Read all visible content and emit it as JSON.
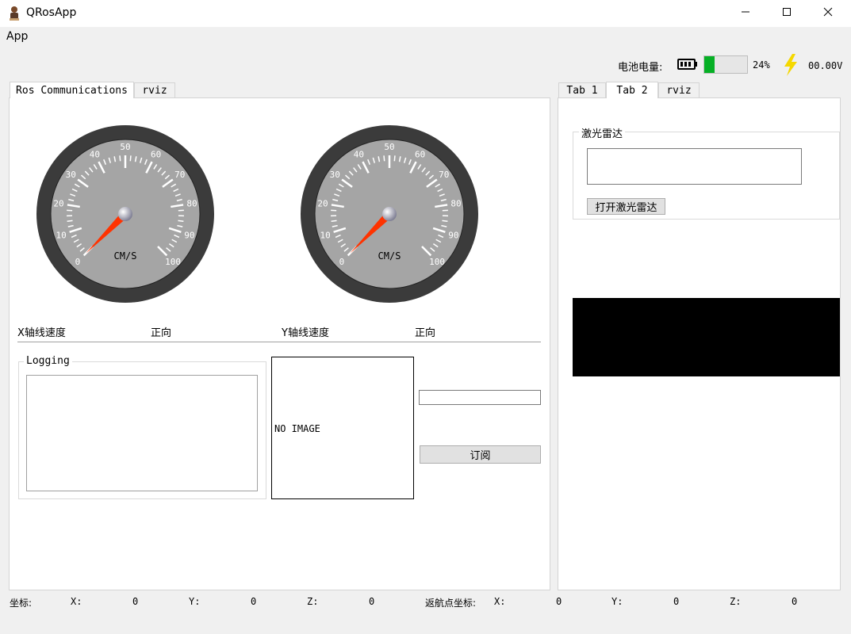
{
  "window": {
    "title": "QRosApp"
  },
  "menu": {
    "app": "App"
  },
  "status": {
    "battery_label": "电池电量:",
    "battery_percent_text": "24%",
    "battery_level": 0.24,
    "battery_color": "#06b025",
    "voltage": "00.00V",
    "bolt_color": "#f5d800"
  },
  "left_tabs": [
    "Ros Communications",
    "rviz"
  ],
  "right_tabs": [
    "Tab 1",
    "Tab 2",
    "rviz"
  ],
  "gauges": [
    {
      "unit": "CM/S",
      "ticks": [
        "0",
        "10",
        "20",
        "30",
        "40",
        "50",
        "60",
        "70",
        "80",
        "90",
        "100"
      ],
      "value": 0
    },
    {
      "unit": "CM/S",
      "ticks": [
        "0",
        "10",
        "20",
        "30",
        "40",
        "50",
        "60",
        "70",
        "80",
        "90",
        "100"
      ],
      "value": 0
    }
  ],
  "speed": {
    "x_label": "X轴线速度",
    "x_direction": "正向",
    "y_label": "Y轴线速度",
    "y_direction": "正向"
  },
  "logging": {
    "title": "Logging"
  },
  "image": {
    "placeholder": "NO IMAGE"
  },
  "subscribe": {
    "button": "订阅"
  },
  "lidar": {
    "title": "激光雷达",
    "button": "打开激光雷达"
  },
  "coords": {
    "label": "坐标:",
    "x_label": "X:",
    "x": "0",
    "y_label": "Y:",
    "y": "0",
    "z_label": "Z:",
    "z": "0",
    "return_label": "返航点坐标:",
    "rx_label": "X:",
    "rx": "0",
    "ry_label": "Y:",
    "ry": "0",
    "rz_label": "Z:",
    "rz": "0"
  },
  "icons": {
    "app": "robot-icon",
    "minimize": "minimize-icon",
    "maximize": "maximize-icon",
    "close": "close-icon",
    "battery": "battery-icon",
    "bolt": "lightning-icon"
  }
}
